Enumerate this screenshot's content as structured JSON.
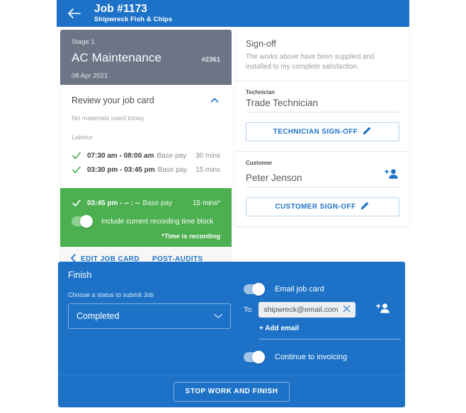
{
  "header": {
    "back_icon": "arrow-left-icon",
    "title": "Job #1173",
    "subtitle": "Shipwreck Fish & Chips",
    "background": "#1d72c7"
  },
  "stage_card": {
    "stage_label": "Stage 1",
    "title": "AC Maintenance",
    "number": "#2361",
    "date": "08 Apr 2021",
    "background": "#6b7586"
  },
  "job_card": {
    "heading": "Review your job card",
    "collapse_icon": "chevron-up-icon",
    "materials_note": "No materials used today.",
    "labour_label": "Labour",
    "labour_rows": [
      {
        "time": "07:30 am - 08:00 am",
        "type": "Base pay",
        "mins": "30 mins"
      },
      {
        "time": "03:30 pm - 03:45 pm",
        "type": "Base pay",
        "mins": "15 mins"
      }
    ],
    "recording": {
      "time": "03:45 pm - -- : --",
      "type": "Base pay",
      "mins": "15 mins*",
      "toggle_label": "Include current recording time block",
      "toggle_on": true,
      "note": "*Time is recording",
      "background": "#4caf50"
    },
    "actions": {
      "back_icon": "chevron-left-icon",
      "edit_label": "EDIT JOB CARD",
      "post_audits_label": "POST-AUDITS"
    }
  },
  "signoff": {
    "title": "Sign-off",
    "description": "The works above have been supplied and installed to my complete satisfaction.",
    "technician": {
      "label": "Technician",
      "value": "Trade Technician",
      "button_label": "TECHNICIAN SIGN-OFF",
      "button_icon": "pencil-icon"
    },
    "customer": {
      "label": "Customer",
      "value": "Peter Jenson",
      "person_icon": "person-add-icon",
      "button_label": "CUSTOMER SIGN-OFF",
      "button_icon": "pencil-icon"
    }
  },
  "finish": {
    "title": "Finish",
    "status_label": "Choose a status to submit Job",
    "status_value": "Completed",
    "status_caret_icon": "chevron-down-icon",
    "email_toggle": {
      "label": "Email job card",
      "on": true
    },
    "to_label": "To:",
    "email_chip": {
      "address": "shipwreck@email.com",
      "remove_icon": "close-icon"
    },
    "person_icon": "person-add-icon",
    "add_email_label": "+ Add email",
    "invoicing_toggle": {
      "label": "Continue to invoicing",
      "on": true
    },
    "submit_label": "STOP WORK AND FINISH",
    "background": "#1d72c7"
  }
}
